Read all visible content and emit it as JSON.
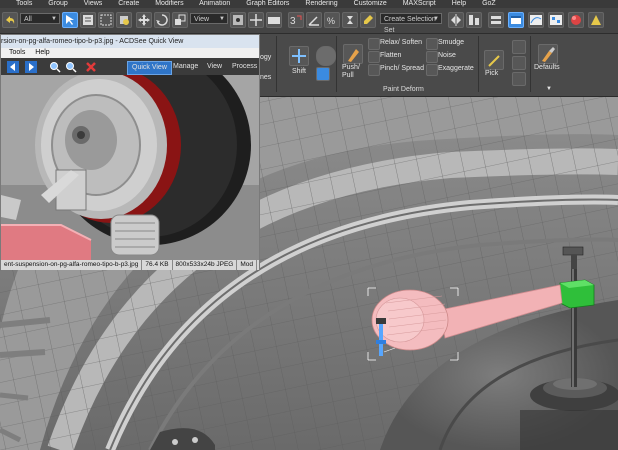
{
  "menubar": {
    "items": [
      "Tools",
      "Group",
      "Views",
      "Create",
      "Modifiers",
      "Animation",
      "Graph Editors",
      "Rendering",
      "Customize",
      "MAXScript",
      "Help",
      "GoZ"
    ]
  },
  "toolbar": {
    "selection_filter": "All",
    "reference_coord": "View",
    "named_selection_placeholder": "Create Selection Set"
  },
  "ribbon": {
    "partial_label": "ogy",
    "partial_label2": "nes",
    "shift_label": "Shift",
    "push_pull_label": "Push/ Pull",
    "relax_soften": "Relax/ Soften",
    "flatten": "Flatten",
    "pinch_spread": "Pinch/ Spread",
    "smudge": "Smudge",
    "noise": "Noise",
    "exaggerate": "Exaggerate",
    "panel_title": "Paint Deform",
    "pick_label": "Pick",
    "defaults_label": "Defaults"
  },
  "acdsee": {
    "title": "rsion-on-pg-alfa-romeo-tipo-b-p3.jpg - ACDSee Quick View",
    "menu": [
      "Tools",
      "Help"
    ],
    "tabs": {
      "quick_view": "Quick View",
      "manage": "Manage",
      "view": "View",
      "process": "Process"
    },
    "status": {
      "filename": "ent-suspension-on-pg-alfa-romeo-tipo-b-p3.jpg",
      "size": "76.4 KB",
      "dimensions": "800x533x24b JPEG",
      "mode": "Mod"
    }
  },
  "colors": {
    "accent_blue": "#3b8be0",
    "gizmo_green": "#2fbf3a",
    "selection_pink": "#f2b2b5",
    "viewport_gray": "#8a8a8a"
  }
}
